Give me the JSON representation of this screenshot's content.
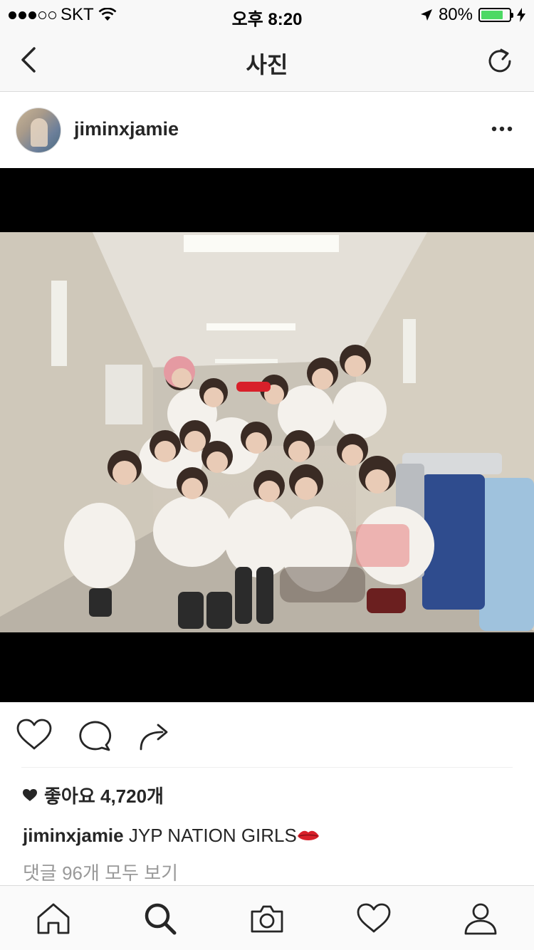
{
  "status_bar": {
    "carrier": "SKT",
    "time": "오후 8:20",
    "battery_percent": "80%",
    "battery_level": 0.8,
    "icons": [
      "signal-dots-icon",
      "wifi-icon",
      "location-arrow-icon",
      "battery-icon",
      "charging-bolt-icon"
    ]
  },
  "nav": {
    "title": "사진",
    "back_icon": "chevron-left-icon",
    "refresh_icon": "refresh-icon"
  },
  "post": {
    "username": "jiminxjamie",
    "more_icon": "more-dots-icon",
    "likes_text": "좋아요 4,720개",
    "caption_user": "jiminxjamie",
    "caption_text": "JYP NATION GIRLS",
    "caption_emoji": "lips-emoji",
    "comments_link": "댓글 96개 모두 보기"
  },
  "actions": {
    "icons": [
      "heart-icon",
      "comment-icon",
      "share-icon"
    ]
  },
  "tab_bar": {
    "icons": [
      "home-icon",
      "search-icon",
      "camera-icon",
      "activity-heart-icon",
      "profile-icon"
    ],
    "active": "search-icon"
  },
  "colors": {
    "status_bg": "#f8f8f8",
    "battery_green": "#4cd964",
    "text": "#262626",
    "muted": "#999999",
    "divider": "#dbdbdb"
  }
}
